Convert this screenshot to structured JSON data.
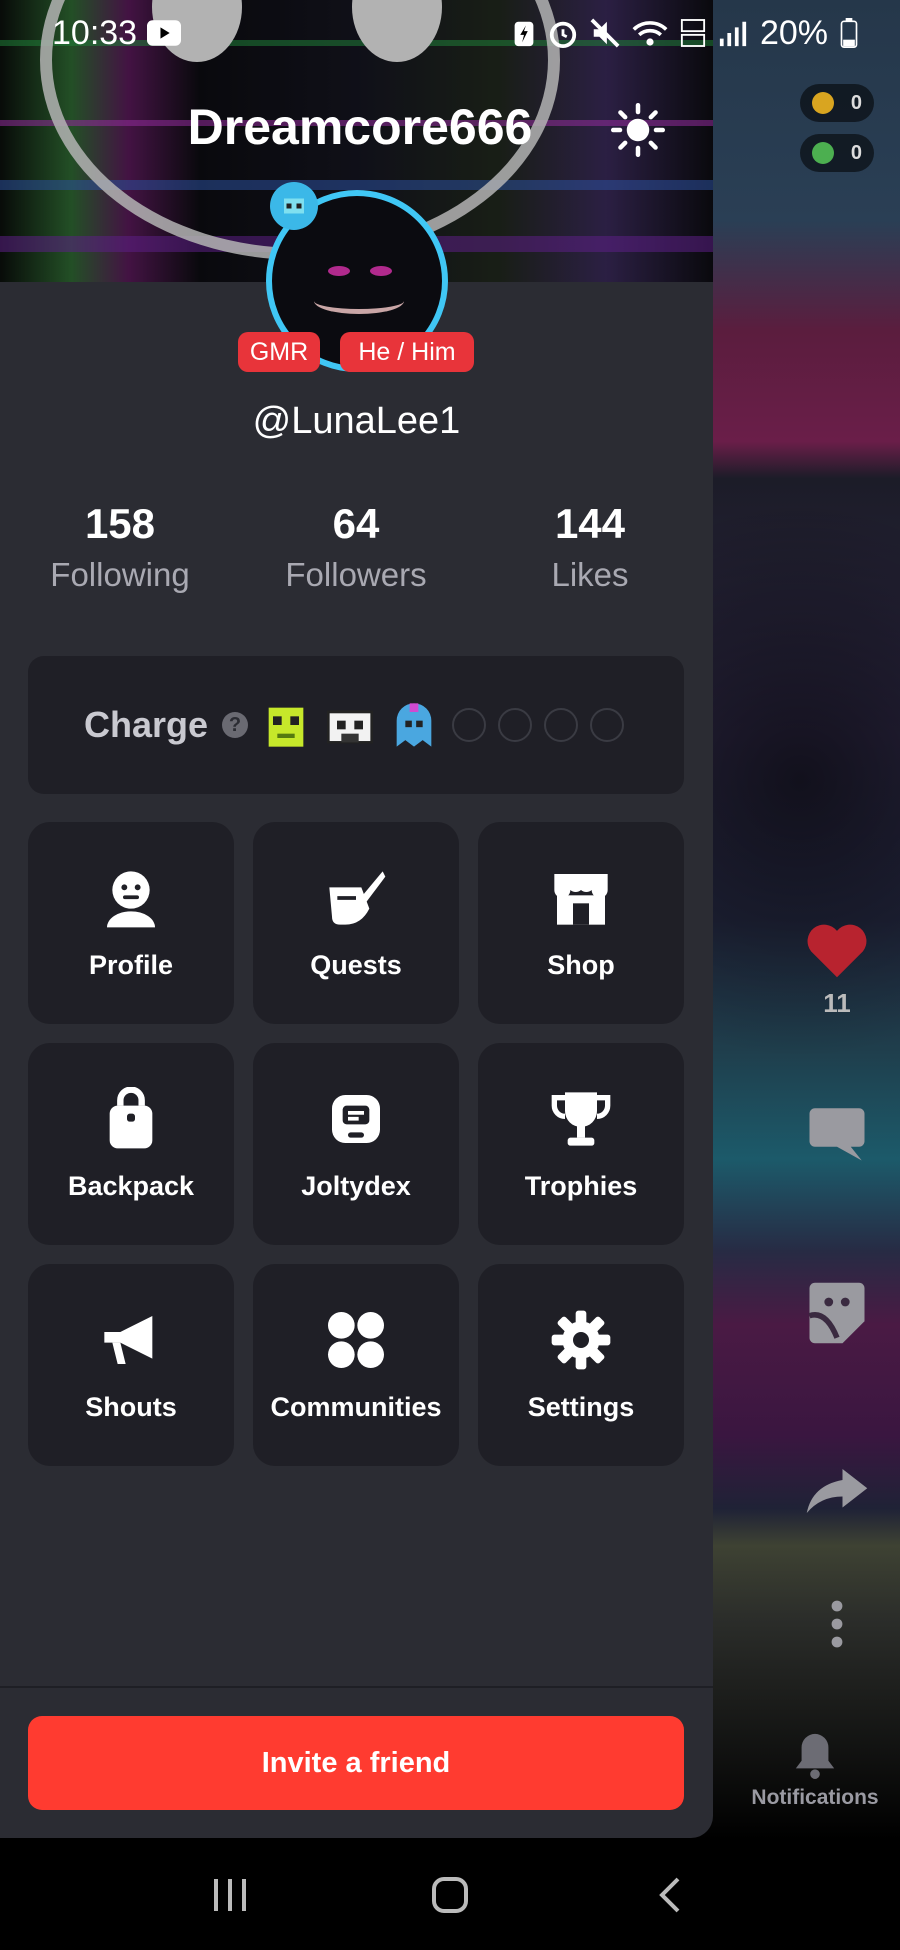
{
  "status_bar": {
    "time": "10:33",
    "battery": "20%",
    "icons": [
      "youtube-icon",
      "battery-saver-icon",
      "alarm-icon",
      "mute-icon",
      "wifi-icon",
      "volte-icon",
      "signal-icon",
      "battery-icon"
    ]
  },
  "feed": {
    "coins": [
      {
        "value": "0",
        "color": "#d9a520"
      },
      {
        "value": "0",
        "color": "#4caf50"
      }
    ],
    "like_count": "11",
    "notifications_label": "Notifications"
  },
  "drawer": {
    "banner_title": "Dreamcore666",
    "tags": [
      "GMR",
      "He / Him"
    ],
    "handle": "@LunaLee1",
    "stats": [
      {
        "value": "158",
        "label": "Following"
      },
      {
        "value": "64",
        "label": "Followers"
      },
      {
        "value": "144",
        "label": "Likes"
      }
    ],
    "charge": {
      "label": "Charge",
      "help": "?",
      "pets": [
        {
          "name": "frog-pet-icon",
          "color": "#c6e82a"
        },
        {
          "name": "cow-pet-icon",
          "color": "#f2f2f2"
        },
        {
          "name": "ghost-pet-icon",
          "color": "#4aa7e0"
        }
      ],
      "empty_slots": 4
    },
    "menu": [
      {
        "label": "Profile",
        "icon": "profile-icon"
      },
      {
        "label": "Quests",
        "icon": "quests-icon"
      },
      {
        "label": "Shop",
        "icon": "shop-icon"
      },
      {
        "label": "Backpack",
        "icon": "backpack-icon"
      },
      {
        "label": "Joltydex",
        "icon": "joltydex-icon"
      },
      {
        "label": "Trophies",
        "icon": "trophy-icon"
      },
      {
        "label": "Shouts",
        "icon": "megaphone-icon"
      },
      {
        "label": "Communities",
        "icon": "communities-icon"
      },
      {
        "label": "Settings",
        "icon": "gear-icon"
      }
    ],
    "invite_label": "Invite a friend"
  },
  "colors": {
    "drawer_bg": "#2b2c33",
    "tile_bg": "#1f1f26",
    "accent_red": "#ff3b30",
    "tag_red": "#e8343a",
    "avatar_ring": "#40c7f5"
  }
}
